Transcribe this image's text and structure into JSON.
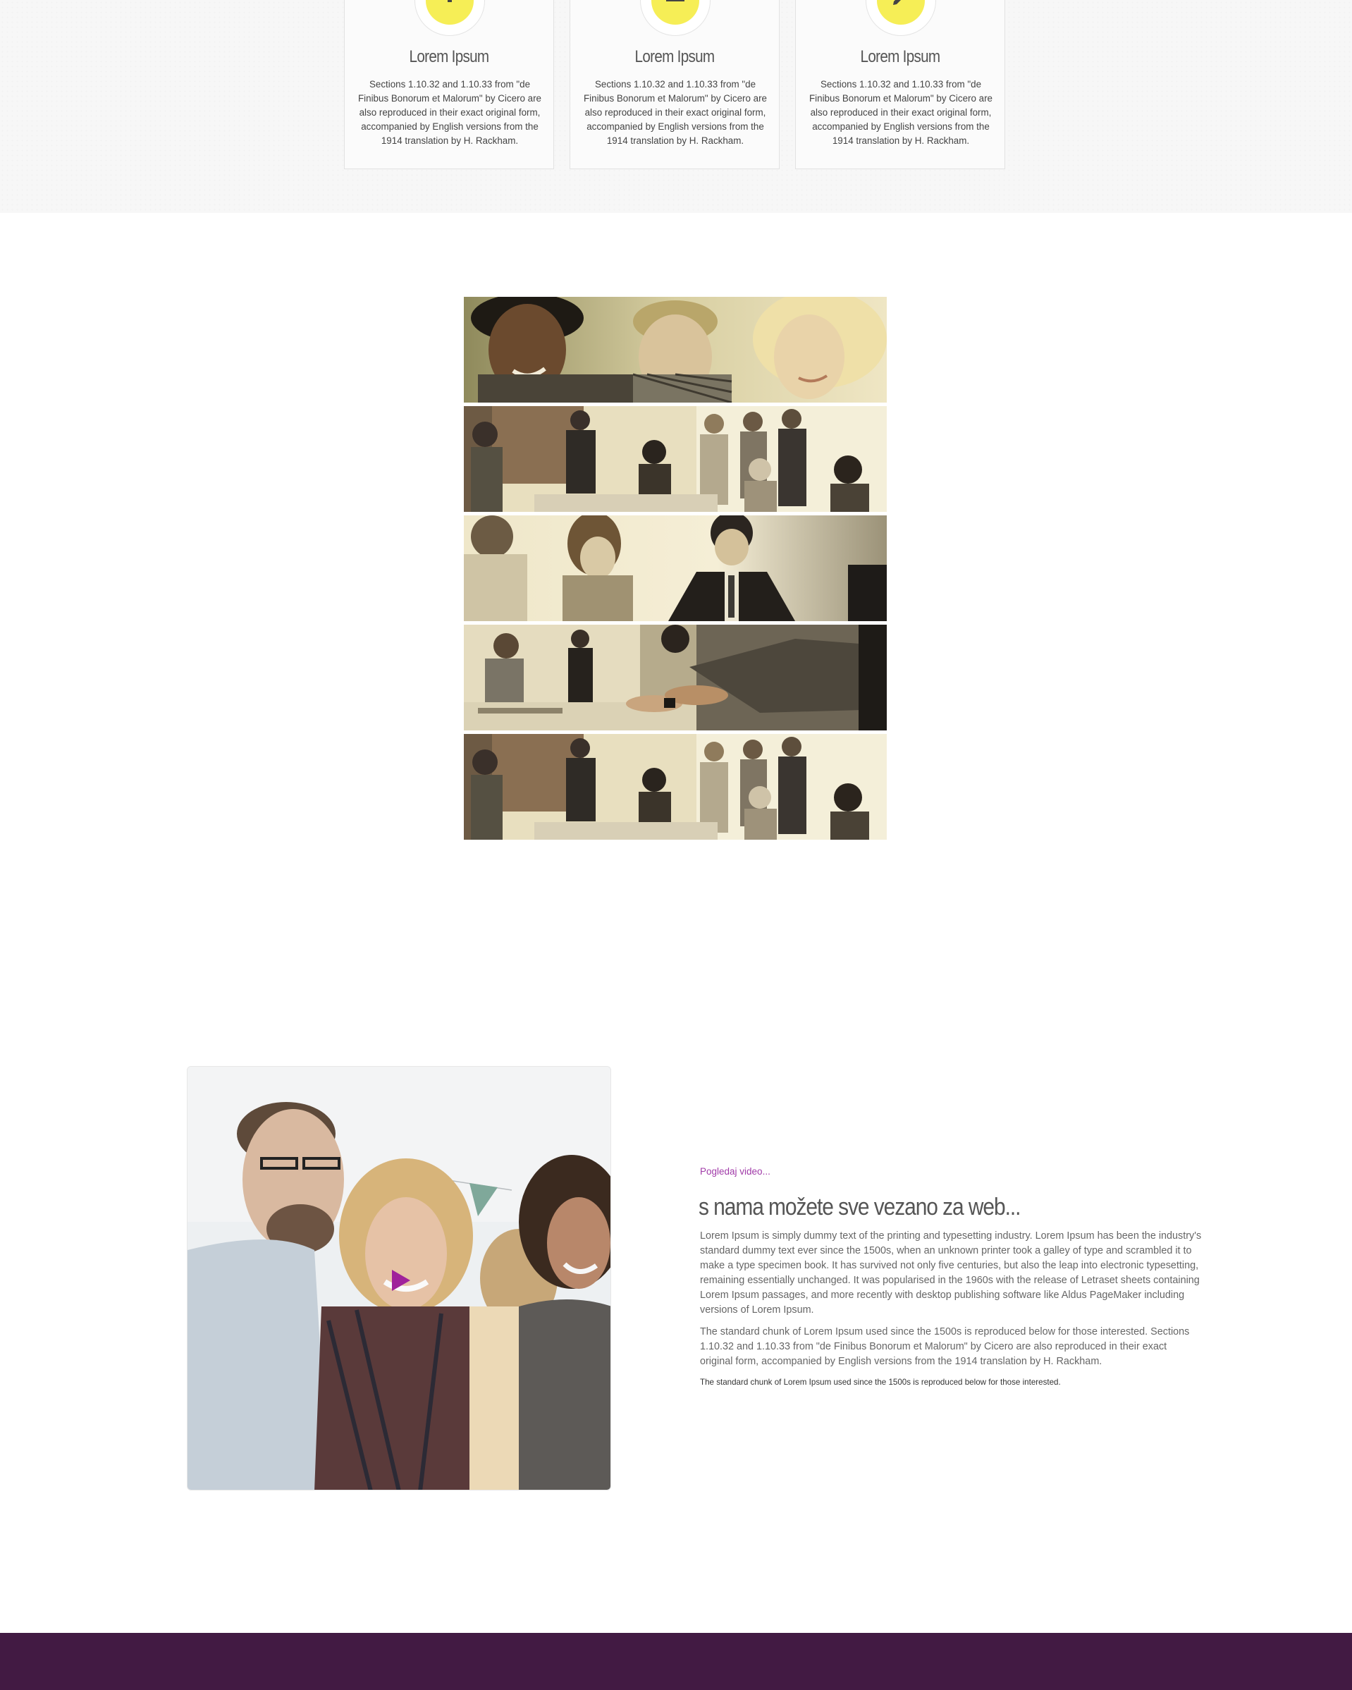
{
  "features": [
    {
      "icon": "lightbulb-icon",
      "title": "Lorem Ipsum",
      "text": "Sections 1.10.32 and 1.10.33 from \"de Finibus Bonorum et Malorum\" by Cicero are also reproduced in their exact original form, accompanied by English versions from the 1914 translation by H. Rackham."
    },
    {
      "icon": "laptop-icon",
      "title": "Lorem Ipsum",
      "text": "Sections 1.10.32 and 1.10.33 from \"de Finibus Bonorum et Malorum\" by Cicero are also reproduced in their exact original form, accompanied by English versions from the 1914 translation by H. Rackham."
    },
    {
      "icon": "pencil-icon",
      "title": "Lorem Ipsum",
      "text": "Sections 1.10.32 and 1.10.33 from \"de Finibus Bonorum et Malorum\" by Cicero are also reproduced in their exact original form, accompanied by English versions from the 1914 translation by H. Rackham."
    }
  ],
  "about": {
    "video_link": "Pogledaj video...",
    "heading": "s nama možete sve vezano za web...",
    "paragraph1": "Lorem Ipsum is simply dummy text of the printing and typesetting industry. Lorem Ipsum has been the industry's standard dummy text ever since the 1500s, when an unknown printer took a galley of type and scrambled it to make a type specimen book. It has survived not only five centuries, but also the leap into electronic typesetting, remaining essentially unchanged. It was popularised in the 1960s with the release of Letraset sheets containing Lorem Ipsum passages, and more recently with desktop publishing software like Aldus PageMaker including versions of Lorem Ipsum.",
    "paragraph2": "The standard chunk of Lorem Ipsum used since the 1500s is reproduced below for those interested. Sections 1.10.32 and 1.10.33 from \"de Finibus Bonorum et Malorum\" by Cicero are also reproduced in their exact original form, accompanied by English versions from the 1914 translation by H. Rackham.",
    "note": "The standard chunk of Lorem Ipsum used since the 1500s is reproduced below for those interested."
  },
  "colors": {
    "icon_yellow": "#f6ee56",
    "link_purple": "#a03aa8",
    "play_magenta": "#a0229b",
    "footer_purple": "#421a43",
    "sepia_light": "#efe6c4",
    "sepia_dark": "#3b342a"
  }
}
